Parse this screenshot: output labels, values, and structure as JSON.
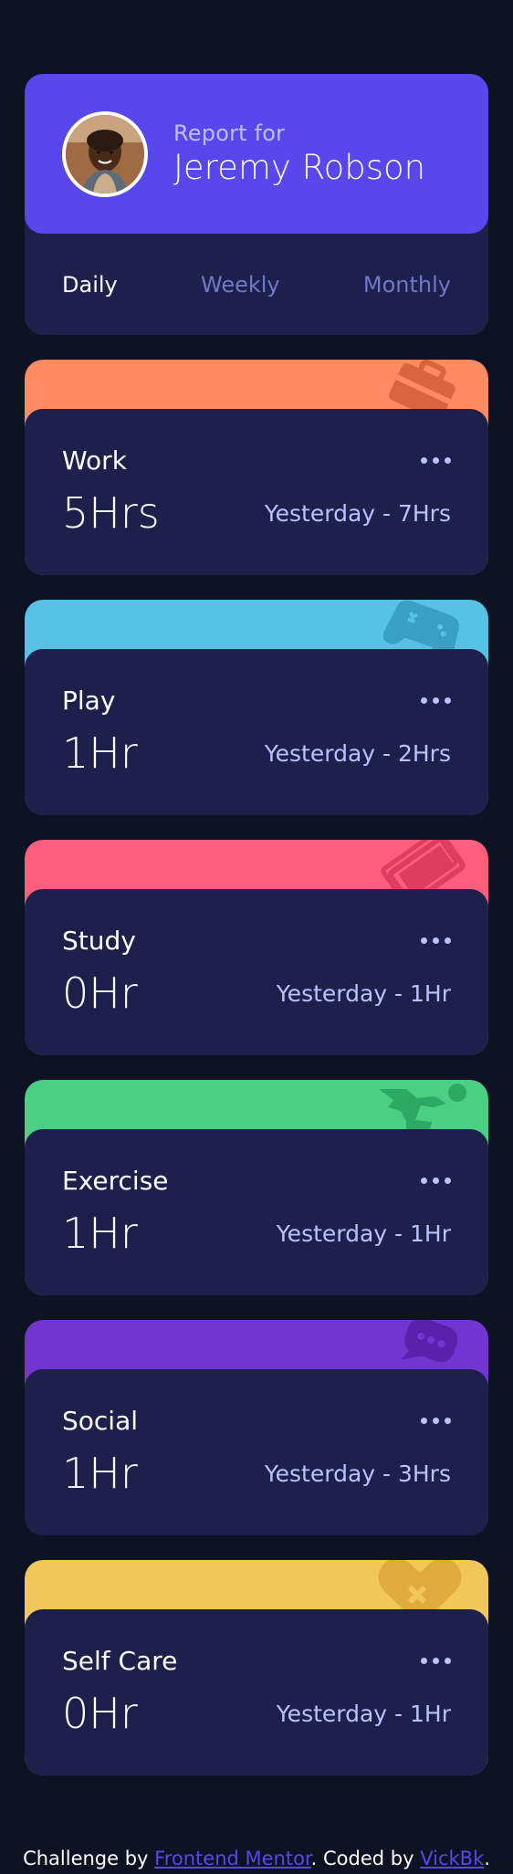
{
  "profile": {
    "report_label": "Report for",
    "name": "Jeremy Robson",
    "avatar": "avatar-photo"
  },
  "periods": [
    {
      "label": "Daily",
      "active": true
    },
    {
      "label": "Weekly",
      "active": false
    },
    {
      "label": "Monthly",
      "active": false
    }
  ],
  "activities": [
    {
      "title": "Work",
      "hours": "5Hrs",
      "previous": "Yesterday - 7Hrs",
      "color": "#ff8b64",
      "icon": "briefcase-icon"
    },
    {
      "title": "Play",
      "hours": "1Hr",
      "previous": "Yesterday - 2Hrs",
      "color": "#55c2e6",
      "icon": "gamepad-icon"
    },
    {
      "title": "Study",
      "hours": "0Hr",
      "previous": "Yesterday - 1Hr",
      "color": "#ff5e7d",
      "icon": "book-icon"
    },
    {
      "title": "Exercise",
      "hours": "1Hr",
      "previous": "Yesterday - 1Hr",
      "color": "#4bcf82",
      "icon": "running-person-icon"
    },
    {
      "title": "Social",
      "hours": "1Hr",
      "previous": "Yesterday - 3Hrs",
      "color": "#7335d2",
      "icon": "chat-bubble-icon"
    },
    {
      "title": "Self Care",
      "hours": "0Hr",
      "previous": "Yesterday - 1Hr",
      "color": "#f1c75b",
      "icon": "heart-icon"
    }
  ],
  "footer": {
    "prefix": "Challenge by ",
    "link1": "Frontend Mentor",
    "middle": ". Coded by ",
    "link2": "VickBk",
    "suffix": "."
  }
}
